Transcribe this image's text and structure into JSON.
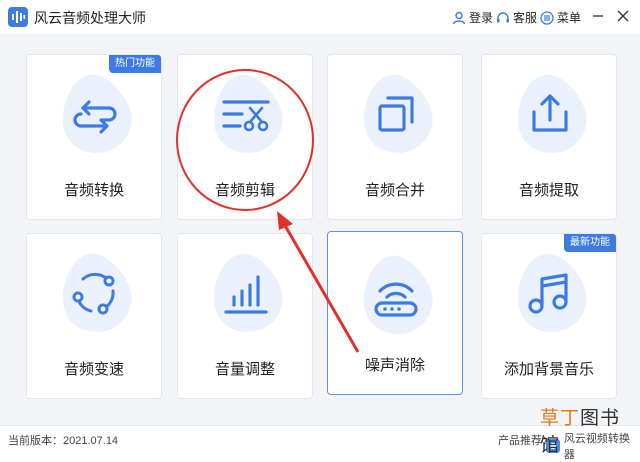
{
  "app": {
    "title": "风云音频处理大师"
  },
  "toolbar": {
    "login": "登录",
    "service": "客服",
    "menu": "菜单"
  },
  "colors": {
    "accent": "#3d7be3",
    "blob": "#eaf1fc",
    "annotation": "#e0312b"
  },
  "cards": [
    {
      "label": "音频转换",
      "icon": "convert-arrows-icon",
      "badge": "热门功能"
    },
    {
      "label": "音频剪辑",
      "icon": "scissors-edit-icon"
    },
    {
      "label": "音频合并",
      "icon": "merge-squares-icon"
    },
    {
      "label": "音频提取",
      "icon": "extract-upload-icon"
    },
    {
      "label": "音频变速",
      "icon": "speed-circle-icon"
    },
    {
      "label": "音量调整",
      "icon": "volume-bars-icon"
    },
    {
      "label": "噪声消除",
      "icon": "noise-router-icon"
    },
    {
      "label": "添加背景音乐",
      "icon": "music-note-icon",
      "badge": "最新功能"
    }
  ],
  "status": {
    "version": "当前版本：2021.07.14",
    "recommend_label": "产品推荐：",
    "recommend_product": "风云视频转换器"
  },
  "watermark": {
    "part1": "草丁",
    "part2": "图书馆"
  }
}
